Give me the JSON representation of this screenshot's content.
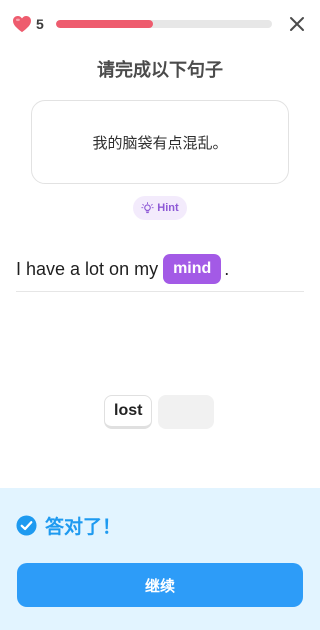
{
  "status": {
    "hearts": "5",
    "progress_fraction": 0.45,
    "heart_color": "#ee5c6e"
  },
  "lesson": {
    "title": "请完成以下句子",
    "prompt": "我的脑袋有点混乱。",
    "hint_label": "Hint",
    "sentence_prefix": "I have a lot on my",
    "answer": "mind",
    "sentence_suffix": ".",
    "word_bank": [
      "lost"
    ]
  },
  "feedback": {
    "message": "答对了！",
    "continue_label": "继续",
    "accent_color": "#2d9cf8"
  },
  "icons": [
    "heart-icon",
    "close-icon",
    "lightbulb-icon",
    "check-circle-icon"
  ]
}
